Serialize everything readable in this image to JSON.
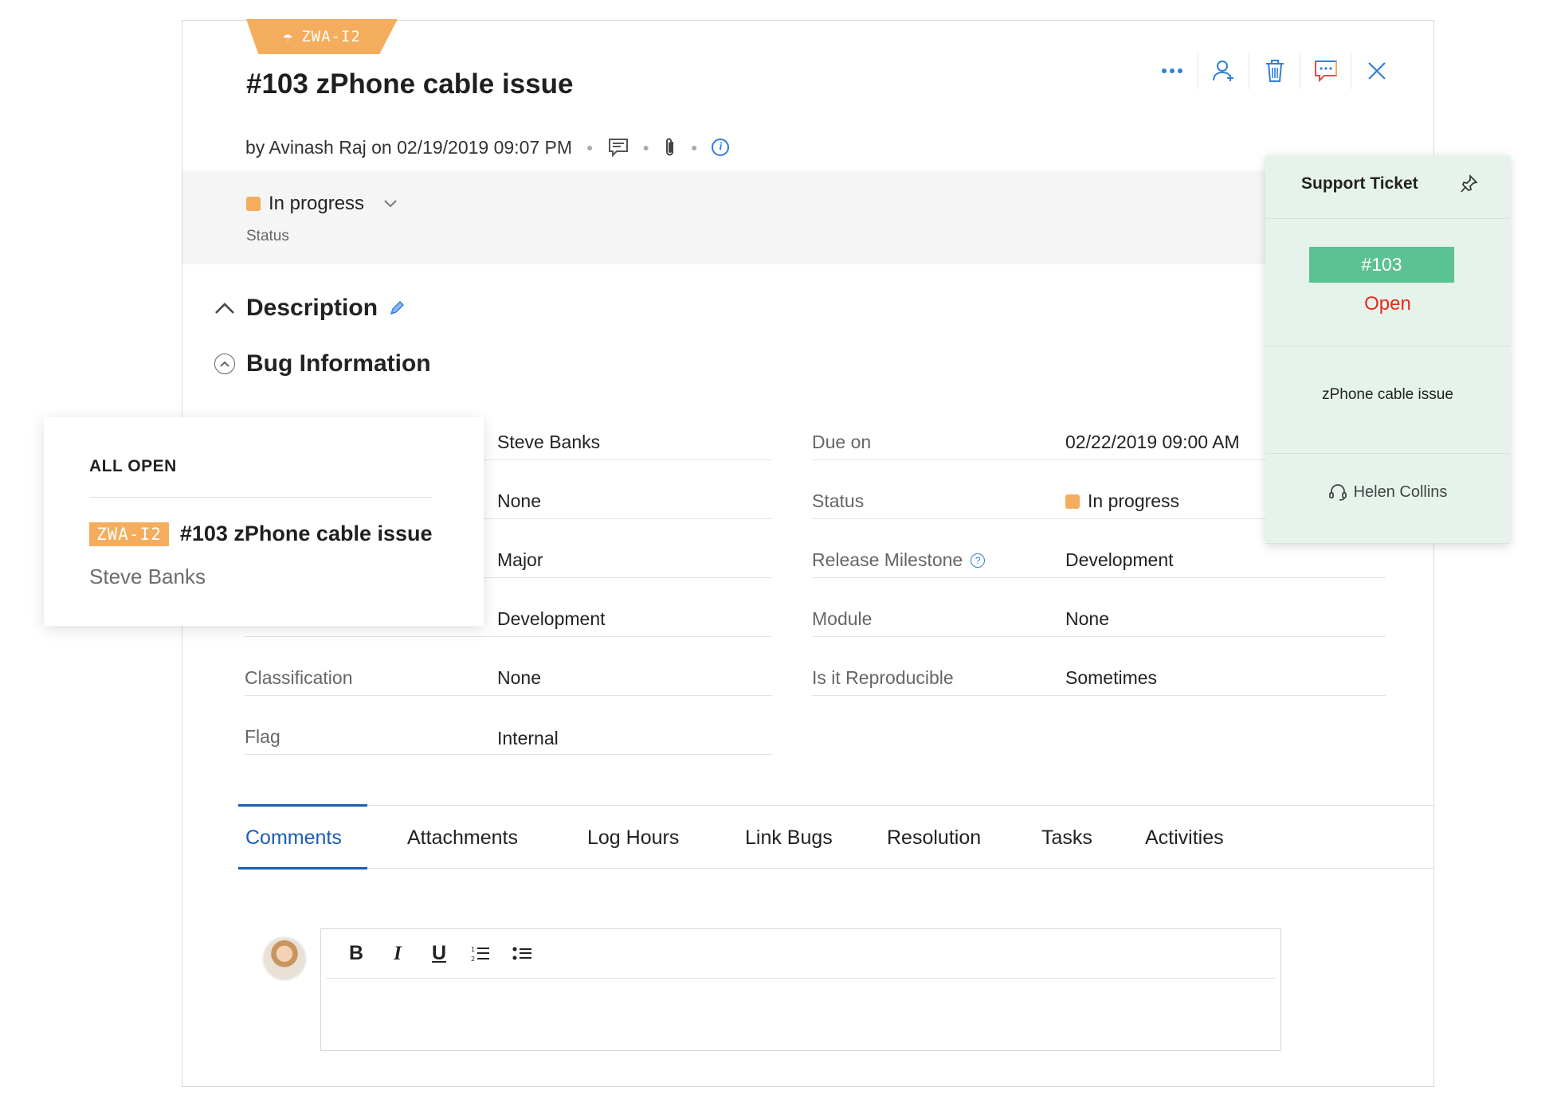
{
  "ticket_header": {
    "bug_id": "ZWA-I2",
    "title": "#103 zPhone cable issue",
    "byline": "by Avinash Raj on 02/19/2019 09:07 PM"
  },
  "status": {
    "value": "In progress",
    "label": "Status",
    "color": "#f4ad5d"
  },
  "sections": {
    "description": "Description",
    "bug_information": "Bug Information"
  },
  "fields": {
    "left": [
      {
        "label": "",
        "value": "Steve Banks"
      },
      {
        "label": "",
        "value": "None"
      },
      {
        "label": "",
        "value": "Major"
      },
      {
        "label": "",
        "value": "Development"
      },
      {
        "label": "Classification",
        "value": "None"
      },
      {
        "label": "Flag",
        "value": "Internal"
      }
    ],
    "right": [
      {
        "label": "Due on",
        "value": "02/22/2019 09:00 AM"
      },
      {
        "label": "Status",
        "value": "In progress"
      },
      {
        "label": "Release Milestone",
        "value": "Development"
      },
      {
        "label": "Module",
        "value": "None"
      },
      {
        "label": "Is it Reproducible",
        "value": "Sometimes"
      }
    ]
  },
  "tabs": [
    "Comments",
    "Attachments",
    "Log Hours",
    "Link Bugs",
    "Resolution",
    "Tasks",
    "Activities"
  ],
  "active_tab": "Comments",
  "editor": {
    "bold": "B",
    "italic": "I",
    "underline": "U"
  },
  "popup": {
    "heading": "ALL OPEN",
    "tag": "ZWA-I2",
    "title": "#103 zPhone cable issue",
    "subtitle": "Steve Banks"
  },
  "support_ticket": {
    "heading": "Support Ticket",
    "number": "#103",
    "state": "Open",
    "subject": "zPhone cable issue",
    "agent": "Helen Collins"
  },
  "colors": {
    "accent": "#1b5db4",
    "tag": "#f4ad5d",
    "ticket_bg": "#e6f3eb",
    "ticket_badge": "#5cc193",
    "open_red": "#e62a1a"
  }
}
